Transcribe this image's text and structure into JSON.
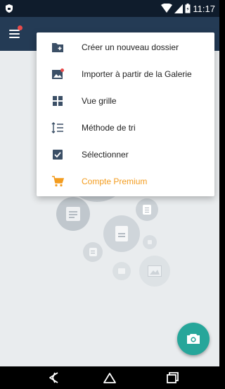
{
  "status_bar": {
    "time": "11:17"
  },
  "menu": {
    "items": [
      {
        "label": "Créer un nouveau dossier",
        "icon": "new-folder-icon"
      },
      {
        "label": "Importer à partir de la Galerie",
        "icon": "gallery-import-icon"
      },
      {
        "label": "Vue grille",
        "icon": "grid-view-icon"
      },
      {
        "label": "Méthode de tri",
        "icon": "sort-icon"
      },
      {
        "label": "Sélectionner",
        "icon": "checkbox-icon"
      },
      {
        "label": "Compte Premium",
        "icon": "cart-icon"
      }
    ]
  },
  "colors": {
    "status_bar": "#0f1c2c",
    "app_bar": "#243b55",
    "accent_fab": "#26a69a",
    "premium": "#f39c1f",
    "notification_dot": "#e84b4b"
  }
}
